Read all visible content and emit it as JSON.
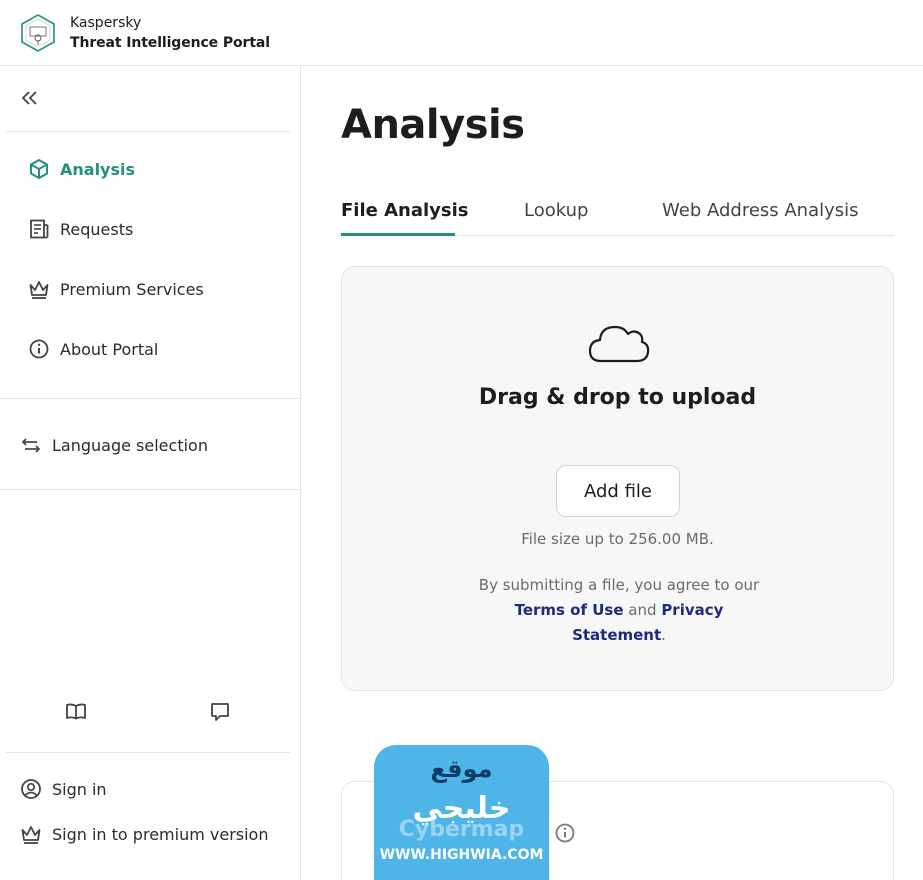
{
  "header": {
    "brand_line1": "Kaspersky",
    "brand_line2": "Threat Intelligence Portal",
    "logo_icon": "kaspersky-logo-icon"
  },
  "sidebar": {
    "collapse_icon": "double-chevron-left-icon",
    "items": [
      {
        "label": "Analysis",
        "icon": "cube-icon",
        "active": true
      },
      {
        "label": "Requests",
        "icon": "document-icon",
        "active": false
      },
      {
        "label": "Premium Services",
        "icon": "crown-icon",
        "active": false
      },
      {
        "label": "About Portal",
        "icon": "info-icon",
        "active": false
      }
    ],
    "language": {
      "label": "Language selection",
      "icon": "swap-arrows-icon"
    },
    "bottom_icons": [
      "book-icon",
      "chat-icon"
    ],
    "account": [
      {
        "label": "Sign in",
        "icon": "user-circle-icon"
      },
      {
        "label": "Sign in to premium version",
        "icon": "crown-icon"
      }
    ]
  },
  "main": {
    "title": "Analysis",
    "tabs": [
      {
        "label": "File Analysis",
        "active": true
      },
      {
        "label": "Lookup",
        "active": false
      },
      {
        "label": "Web Address Analysis",
        "active": false
      }
    ],
    "dropzone": {
      "icon": "cloud-icon",
      "title": "Drag & drop to upload",
      "button_label": "Add file",
      "size_note": "File size up to 256.00 MB.",
      "terms_prefix": "By submitting a file, you agree to our",
      "terms_link": "Terms of Use",
      "terms_and": "and",
      "privacy_link": "Privacy Statement",
      "terms_suffix": "."
    }
  },
  "watermark": {
    "top": "موقع",
    "middle": "خليجي",
    "brand": "Cybermap",
    "url": "WWW.HIGHWIA.COM"
  },
  "colors": {
    "accent": "#23917d",
    "link": "#1f2a7a",
    "watermark_bg": "#4fb4e8"
  }
}
